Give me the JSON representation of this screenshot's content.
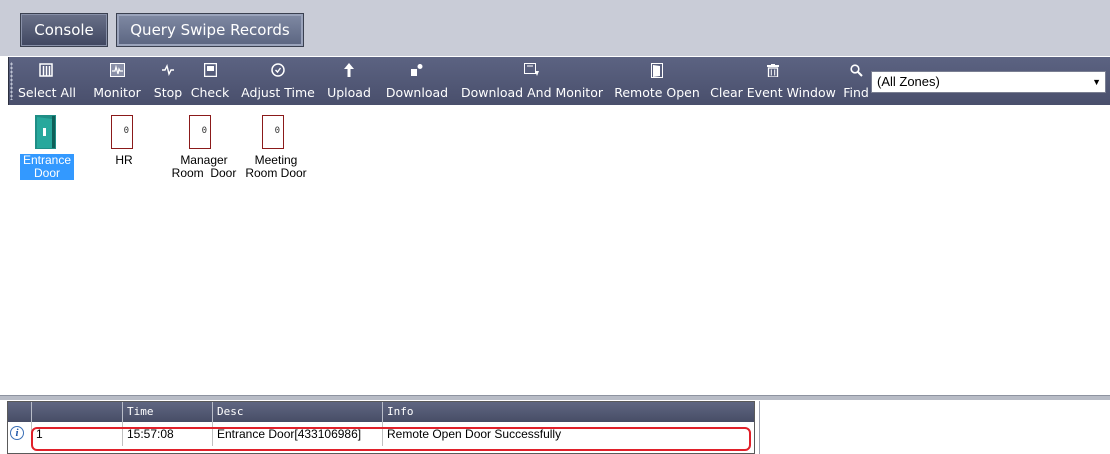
{
  "tabs": [
    {
      "label": "Console"
    },
    {
      "label": "Query Swipe Records"
    }
  ],
  "toolbar": {
    "buttons": [
      {
        "label": "Select All",
        "icon": "select-all-icon"
      },
      {
        "label": "Monitor",
        "icon": "monitor-icon"
      },
      {
        "label": "Stop",
        "icon": "stop-icon"
      },
      {
        "label": "Check",
        "icon": "check-icon"
      },
      {
        "label": "Adjust Time",
        "icon": "clock-icon"
      },
      {
        "label": "Upload",
        "icon": "upload-icon"
      },
      {
        "label": "Download",
        "icon": "download-icon"
      },
      {
        "label": "Download And Monitor",
        "icon": "download-monitor-icon"
      },
      {
        "label": "Remote Open",
        "icon": "door-open-icon"
      },
      {
        "label": "Clear Event Window",
        "icon": "trash-icon"
      },
      {
        "label": "Find",
        "icon": "search-icon"
      }
    ],
    "zone_select": "(All Zones)"
  },
  "doors": [
    {
      "label1": "Entrance",
      "label2": "Door",
      "selected": true,
      "count": ""
    },
    {
      "label1": "HR",
      "label2": "",
      "selected": false,
      "count": "0"
    },
    {
      "label1": "Manager",
      "label2": "Room  Door",
      "selected": false,
      "count": "0"
    },
    {
      "label1": "Meeting",
      "label2": "Room Door",
      "selected": false,
      "count": "0"
    }
  ],
  "events": {
    "columns": [
      "",
      "",
      "Time",
      "Desc",
      "Info"
    ],
    "rows": [
      {
        "index": "1",
        "time": "15:57:08",
        "desc": "Entrance Door[433106986]",
        "info": "Remote Open Door Successfully"
      }
    ]
  }
}
